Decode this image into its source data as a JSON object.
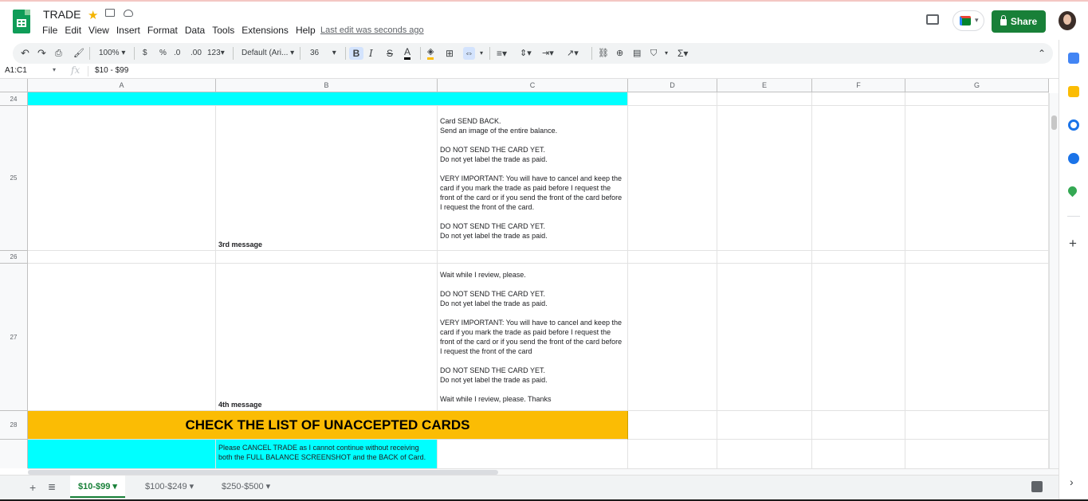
{
  "app": {
    "title": "TRADE",
    "last_edit": "Last edit was seconds ago",
    "share_label": "Share"
  },
  "menu": [
    "File",
    "Edit",
    "View",
    "Insert",
    "Format",
    "Data",
    "Tools",
    "Extensions",
    "Help"
  ],
  "toolbar": {
    "zoom": "100%",
    "currency": "$",
    "percent": "%",
    "dec_decrease": ".0",
    "dec_increase": ".00",
    "more_formats": "123",
    "font": "Default (Ari...",
    "font_size": "36",
    "bold": "B",
    "italic": "I",
    "strike": "S",
    "text_color": "A"
  },
  "formula_bar": {
    "name_box": "A1:C1",
    "fx": "fx",
    "value": "$10 - $99"
  },
  "columns": [
    "A",
    "B",
    "C",
    "D",
    "E",
    "F",
    "G"
  ],
  "rows": [
    {
      "num": "24"
    },
    {
      "num": "25",
      "b": "3rd message",
      "c": "Card SEND BACK.\nSend an image of the entire balance.\n\nDO NOT SEND THE CARD YET.\nDo not yet label the trade as paid.\n\nVERY IMPORTANT: You will have to cancel and keep the card if you mark the trade as paid before I request the front of the card or if you send the front of the card before I request the front of the card.\n\nDO NOT SEND THE CARD YET.\nDo not yet label the trade as paid."
    },
    {
      "num": "26"
    },
    {
      "num": "27",
      "b": "4th message",
      "c": "Wait while I review, please.\n\nDO NOT SEND THE CARD YET.\nDo not yet label the trade as paid.\n\nVERY IMPORTANT: You will have to cancel and keep the card if you mark the trade as paid before I request the front of the card or if you send the front of the card before I request the front of the card\n\nDO NOT SEND THE CARD YET.\nDo not yet label the trade as paid.\n\nWait while I review, please. Thanks"
    },
    {
      "num": "28",
      "merged": "CHECK THE LIST OF UNACCEPTED CARDS"
    },
    {
      "num": "",
      "b": "Please CANCEL TRADE as I cannot continue without receiving both the FULL BALANCE SCREENSHOT and the BACK of Card."
    }
  ],
  "sheet_tabs": [
    "$10-$99",
    "$100-$249",
    "$250-$500"
  ],
  "colors": {
    "cyan": "#00ffff",
    "gold": "#fbbc04",
    "brand_green": "#188038"
  }
}
